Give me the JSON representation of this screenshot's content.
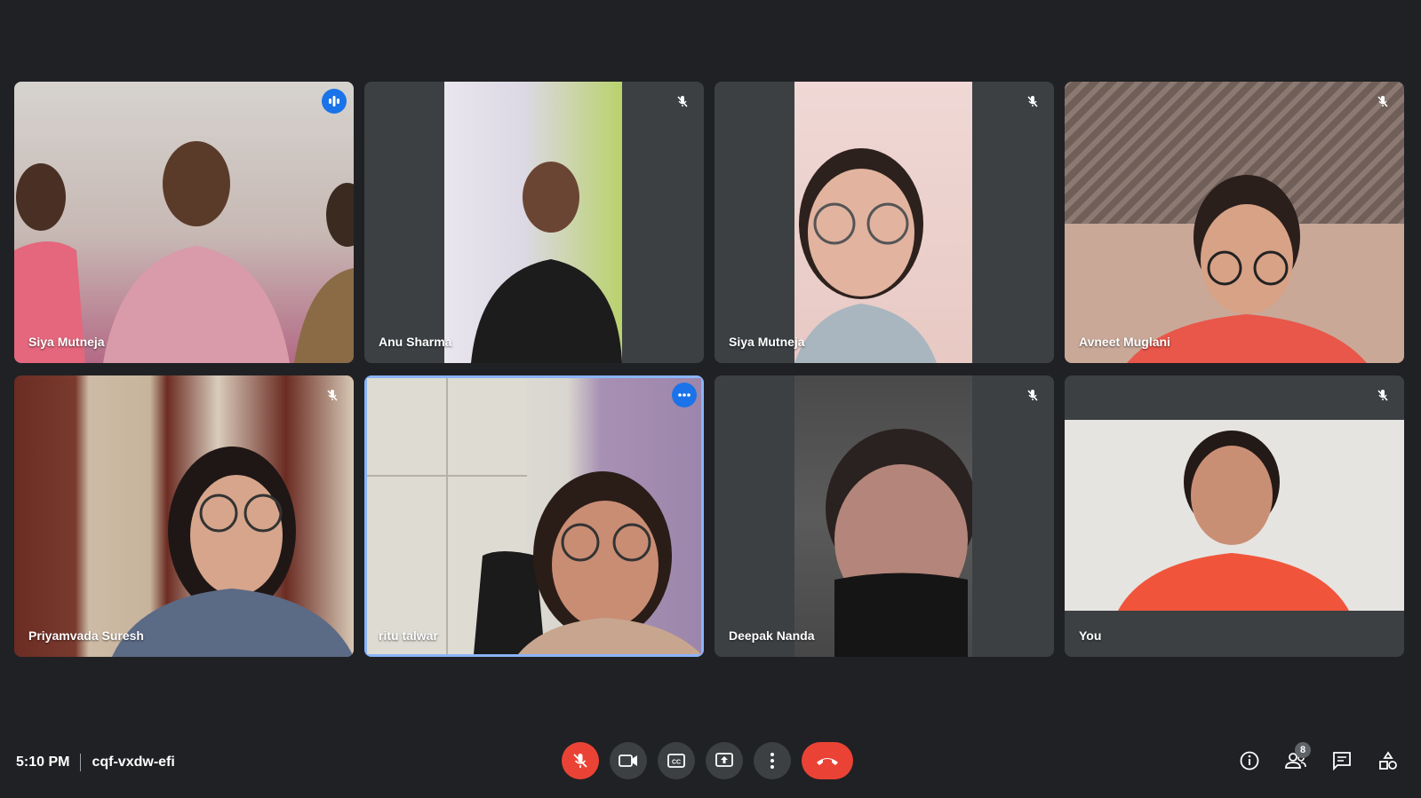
{
  "meeting": {
    "time": "5:10 PM",
    "code": "cqf-vxdw-efi",
    "participant_count": "8"
  },
  "participants": [
    {
      "name": "Siya Mutneja",
      "status": "speaking"
    },
    {
      "name": "Anu Sharma",
      "status": "muted"
    },
    {
      "name": "Siya Mutneja",
      "status": "muted"
    },
    {
      "name": "Avneet Muglani",
      "status": "muted"
    },
    {
      "name": "Priyamvada Suresh",
      "status": "muted"
    },
    {
      "name": "ritu talwar",
      "status": "active"
    },
    {
      "name": "Deepak Nanda",
      "status": "muted"
    },
    {
      "name": "You",
      "status": "muted"
    }
  ],
  "colors": {
    "background": "#202124",
    "tile": "#3c4043",
    "accent": "#1a73e8",
    "danger": "#ea4335"
  },
  "icons": {
    "controls": [
      "mic-off-icon",
      "camera-icon",
      "captions-icon",
      "present-icon",
      "more-options-icon",
      "end-call-icon"
    ],
    "right": [
      "info-icon",
      "people-icon",
      "chat-icon",
      "activities-icon"
    ]
  }
}
